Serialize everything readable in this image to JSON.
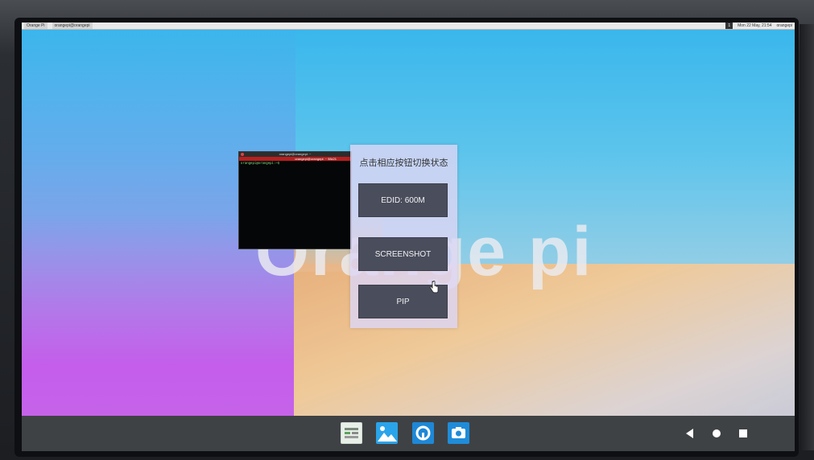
{
  "top_panel": {
    "left_app_1": "Orange Pi",
    "left_app_2": "orangepi@orangepi",
    "right_badge": "1",
    "right_datetime": "Mon 22 May, 21:54",
    "right_user": "orangepi"
  },
  "wallpaper": {
    "logo_text": "Orange pi"
  },
  "terminal": {
    "title": "orangepi@orangepi: ~",
    "tab_label": "orangepi@orangepi: ~ 98x21",
    "prompt_line": "orangepi@orangepi:~$ "
  },
  "dialog": {
    "title": "点击相应按钮切换状态",
    "buttons": [
      {
        "label": "EDID: 600M"
      },
      {
        "label": "SCREENSHOT"
      },
      {
        "label": "PIP"
      }
    ]
  },
  "taskbar": {
    "apps": [
      {
        "icon": "file-manager-icon"
      },
      {
        "icon": "gallery-icon"
      },
      {
        "icon": "browser-icon"
      },
      {
        "icon": "camera-icon"
      }
    ],
    "controls": [
      {
        "icon": "back-icon"
      },
      {
        "icon": "home-icon"
      },
      {
        "icon": "recents-icon"
      }
    ]
  },
  "colors": {
    "dialog_bg": "#dcd6f4",
    "button_bg": "#4a4d5c",
    "navbar_bg": "#3f4245",
    "sky_blue": "#38b6ec",
    "purple": "#c766ea"
  }
}
